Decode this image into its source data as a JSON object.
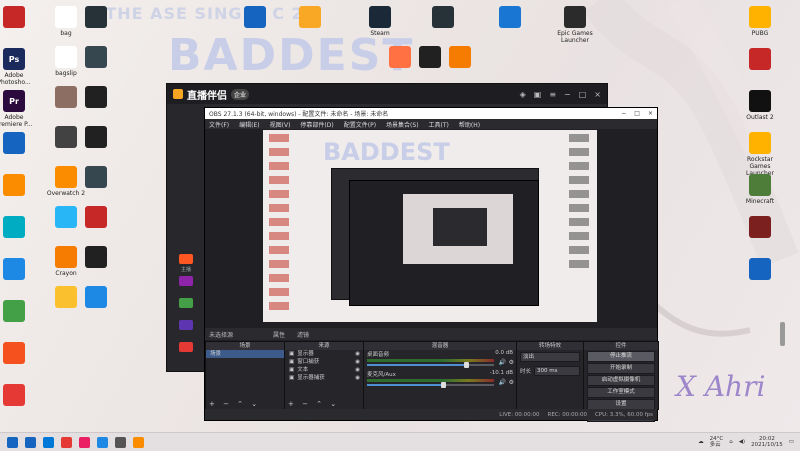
{
  "wallpaper": {
    "banner": "-THE     ASE SINGLE     C      27",
    "title": "BADDEST",
    "signature": "X Ahri"
  },
  "desktop_left": [
    {
      "label": "",
      "color": "#c62828"
    },
    {
      "label": "Adobe Photosho...",
      "color": "#1b2a5c",
      "glyph": "Ps"
    },
    {
      "label": "Adobe Premiere P...",
      "color": "#2b0a3d",
      "glyph": "Pr"
    },
    {
      "label": "",
      "color": "#1565c0"
    },
    {
      "label": "",
      "color": "#fb8c00"
    },
    {
      "label": "",
      "color": "#00acc1"
    },
    {
      "label": "",
      "color": "#1e88e5"
    },
    {
      "label": "",
      "color": "#43a047"
    },
    {
      "label": "",
      "color": "#f4511e"
    },
    {
      "label": "",
      "color": "#e53935"
    }
  ],
  "desktop_col2": [
    {
      "label": "bag",
      "color": "#ffffff"
    },
    {
      "label": "bagslip",
      "color": "#ffffff"
    },
    {
      "label": "",
      "color": "#8d6e63"
    },
    {
      "label": "",
      "color": "#424242"
    },
    {
      "label": "Overwatch 2",
      "color": "#fb8c00"
    },
    {
      "label": "",
      "color": "#29b6f6"
    },
    {
      "label": "Crayon",
      "color": "#f57c00"
    },
    {
      "label": "",
      "color": "#fbc02d"
    }
  ],
  "desktop_col3": [
    {
      "label": "",
      "color": "#263238"
    },
    {
      "label": "",
      "color": "#37474f"
    },
    {
      "label": "",
      "color": "#212121"
    },
    {
      "label": "",
      "color": "#212121"
    },
    {
      "label": "",
      "color": "#37474f"
    },
    {
      "label": "",
      "color": "#c62828"
    },
    {
      "label": "",
      "color": "#212121"
    },
    {
      "label": "",
      "color": "#1e88e5"
    }
  ],
  "desktop_top": [
    {
      "label": "",
      "color": "#1565c0"
    },
    {
      "label": "",
      "color": "#f9a825"
    },
    {
      "label": "Steam",
      "color": "#1b2838"
    },
    {
      "label": "",
      "color": "#263238"
    },
    {
      "label": "",
      "color": "#1976d2"
    },
    {
      "label": "Epic Games Launcher",
      "color": "#2b2b2b"
    },
    {
      "label": "",
      "color": "#ff7043"
    },
    {
      "label": "",
      "color": "#212121"
    },
    {
      "label": "",
      "color": "#f57c00"
    }
  ],
  "desktop_right": [
    {
      "label": "PUBG",
      "color": "#ffb300"
    },
    {
      "label": "",
      "color": "#c62828"
    },
    {
      "label": "Outlast 2",
      "color": "#111111"
    },
    {
      "label": "Rockstar Games Launcher",
      "color": "#ffb300"
    },
    {
      "label": "Minecraft",
      "color": "#4e7d3a"
    },
    {
      "label": "",
      "color": "#7b1f1f"
    },
    {
      "label": "",
      "color": "#1565c0"
    }
  ],
  "toasts": [],
  "host_app": {
    "name": "直播伴侣",
    "badge": "企业",
    "side_items": [
      {
        "label": "主播",
        "color": "#ff5722"
      },
      {
        "label": "",
        "color": "#8e24aa"
      },
      {
        "label": "",
        "color": "#43a047"
      },
      {
        "label": "",
        "color": "#5e35b1"
      },
      {
        "label": "",
        "color": "#e53935"
      }
    ]
  },
  "obs": {
    "title": "OBS 27.1.3 (64-bit, windows) - 配置文件: 未命名 - 场景: 未命名",
    "menu": [
      "文件(F)",
      "编辑(E)",
      "视图(V)",
      "停靠部件(D)",
      "配置文件(P)",
      "场景集合(S)",
      "工具(T)",
      "帮助(H)"
    ],
    "mode_bar": {
      "not_live": "未选择源",
      "props": "属性",
      "filters": "滤镜"
    },
    "docks": {
      "scenes": {
        "header": "场景",
        "items": [
          "场景"
        ]
      },
      "sources": {
        "header": "来源",
        "items": [
          "显示器",
          "窗口捕获",
          "文本",
          "显示器捕获"
        ]
      },
      "mixer": {
        "header": "混音器",
        "channels": [
          {
            "name": "桌面音频",
            "db": "0.0 dB",
            "level": 0.78
          },
          {
            "name": "麦克风/Aux",
            "db": "-10.1 dB",
            "level": 0.6
          }
        ]
      },
      "transitions": {
        "header": "转场特效",
        "type": "淡出",
        "duration_label": "时长",
        "duration": "300 ms"
      },
      "controls": {
        "header": "控件",
        "buttons": [
          "停止推流",
          "开始录制",
          "启动虚拟摄像机",
          "工作室模式",
          "设置",
          "退出"
        ]
      }
    },
    "statusbar": {
      "live": "LIVE: 00:00:00",
      "rec": "REC: 00:00:00",
      "cpu": "CPU: 3.3%, 60.00 fps"
    },
    "footer_icons": "+ − ⌃ ⌄"
  },
  "taskbar": {
    "icons": [
      "#1565c0",
      "#0078d7",
      "#e53935",
      "#e91e63",
      "#1e88e5",
      "#555555",
      "#fb8c00"
    ],
    "weather": "24°C",
    "weather_label": "多云",
    "time": "20:02",
    "date": "2021/10/15"
  }
}
